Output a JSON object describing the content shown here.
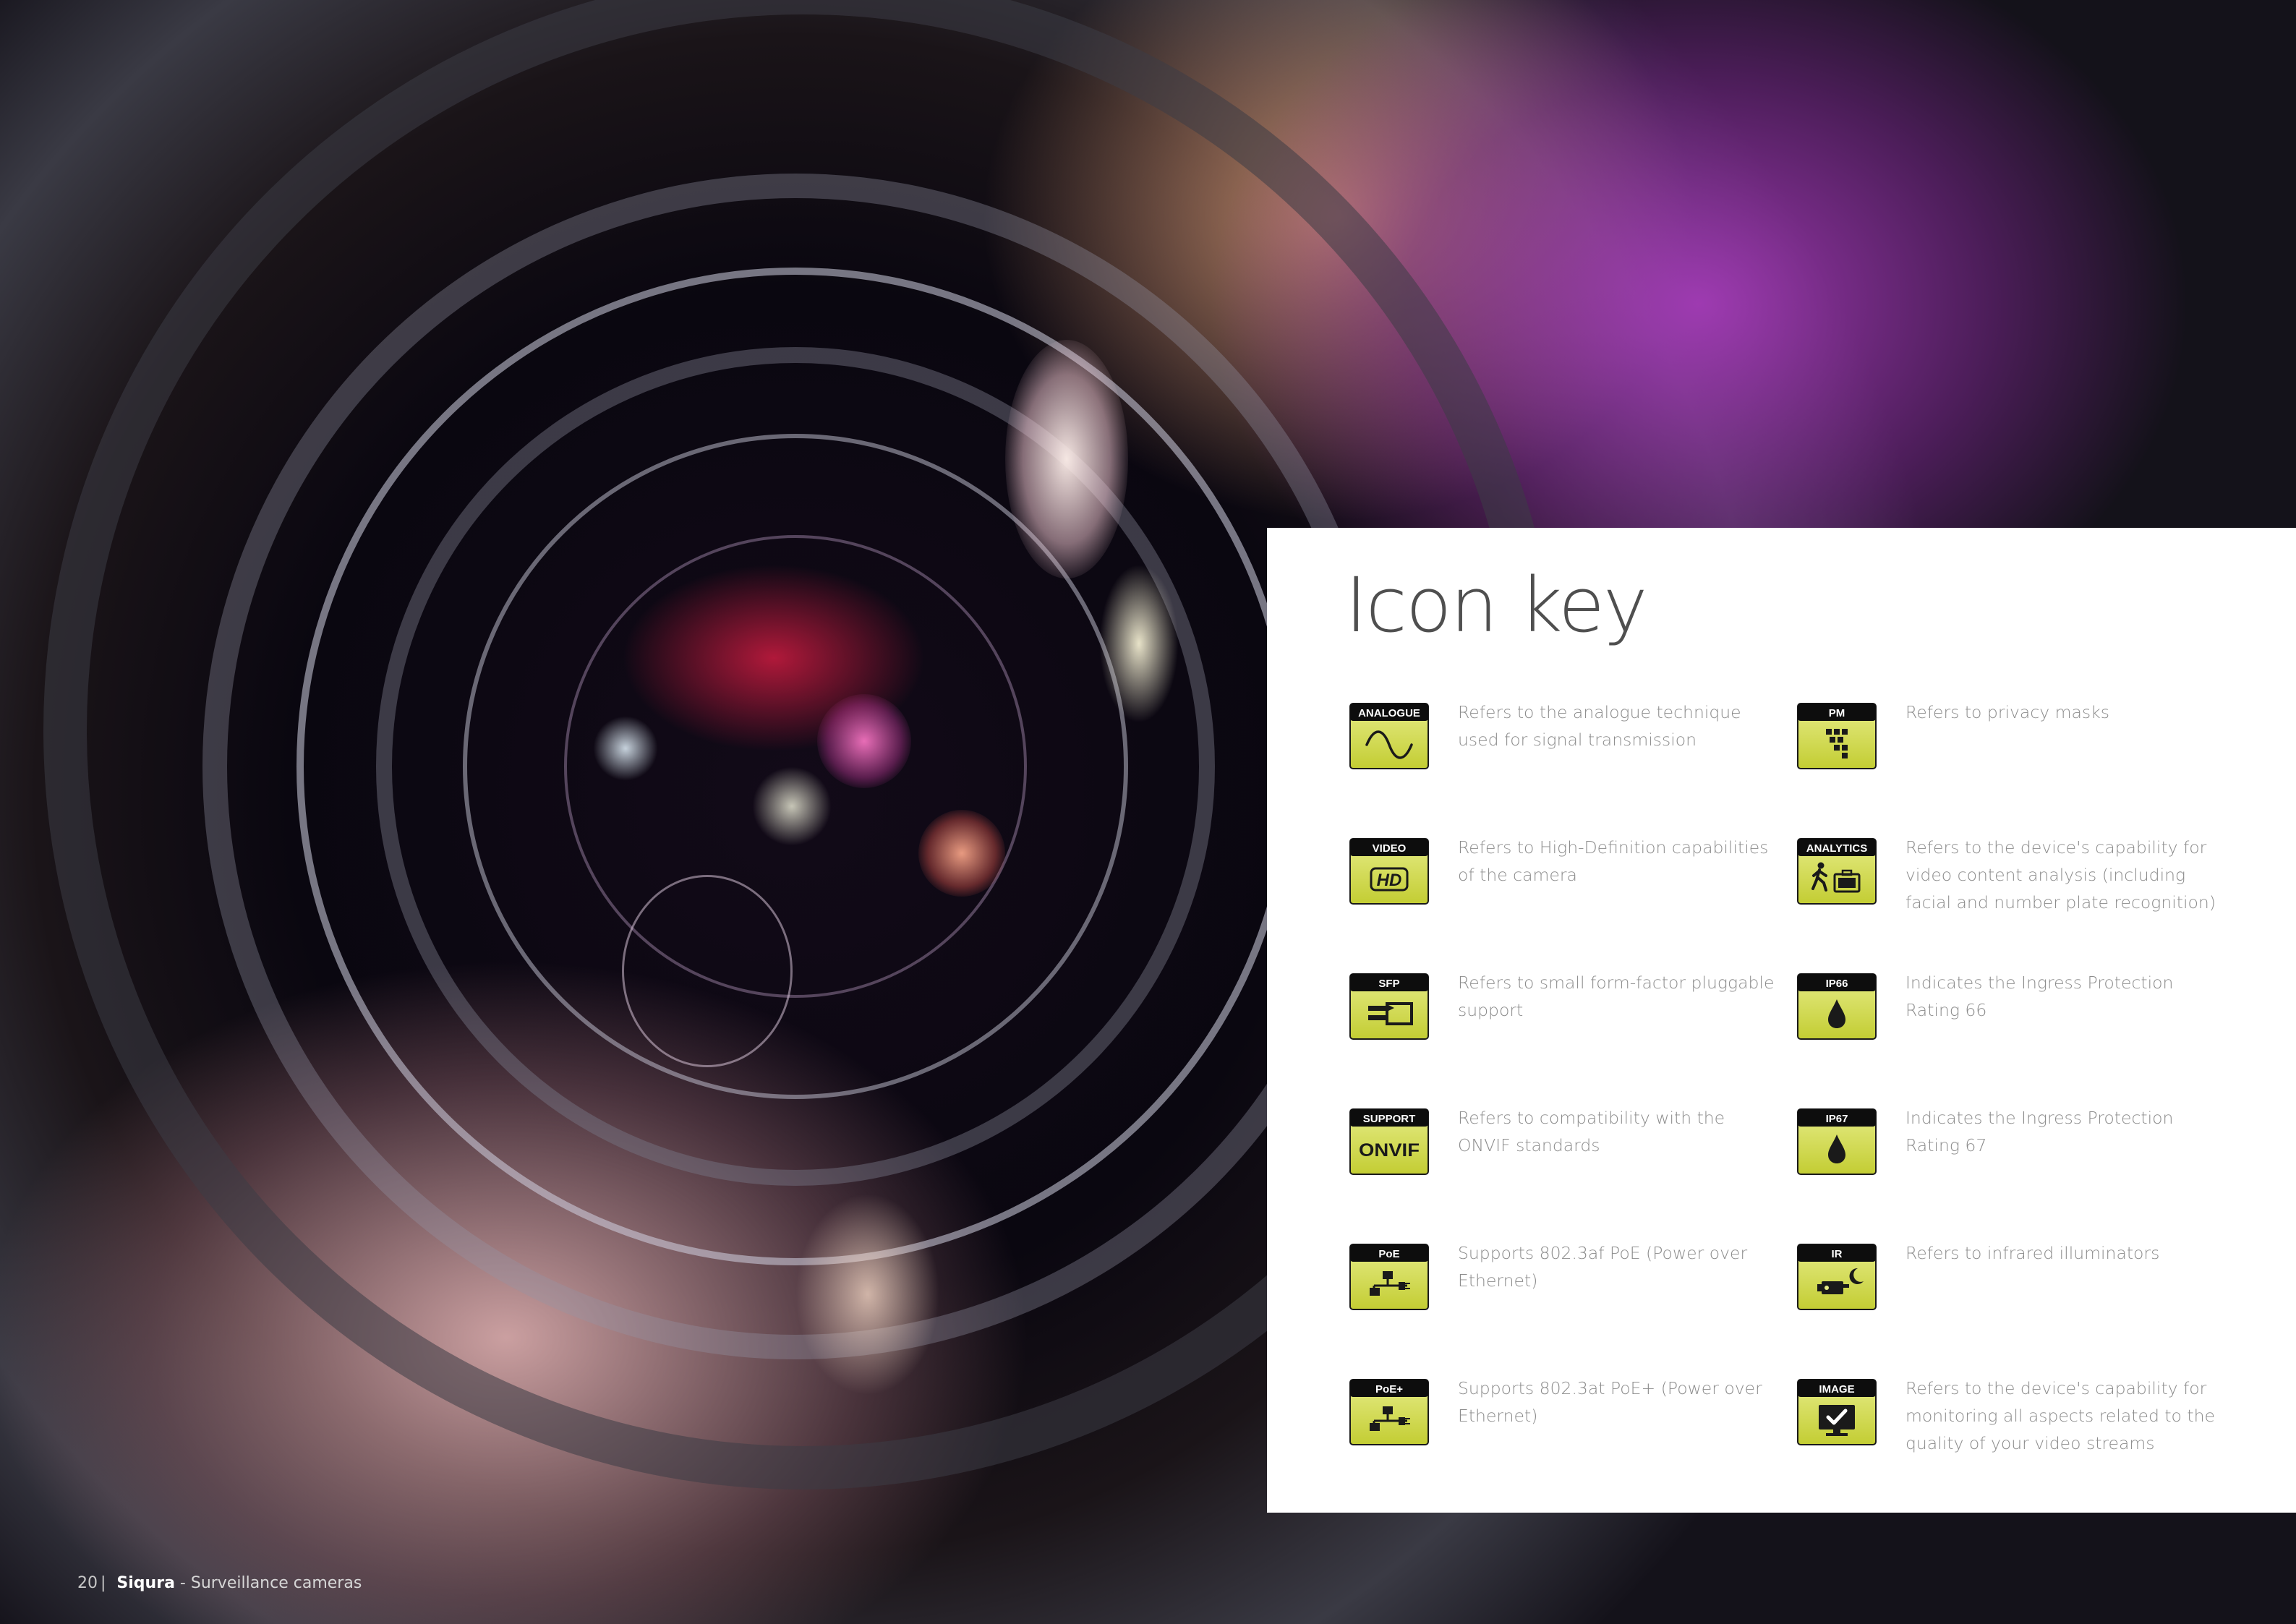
{
  "panel": {
    "title": "Icon key"
  },
  "icons": [
    {
      "badge": "ANALOGUE",
      "symbol": "sine-wave-icon",
      "desc": "Refers to the analogue technique used for signal transmission"
    },
    {
      "badge": "PM",
      "symbol": "privacy-mask-icon",
      "desc": "Refers to privacy masks"
    },
    {
      "badge": "VIDEO",
      "symbol": "hd-icon",
      "symbol_text": "HD",
      "desc": "Refers to High-Definition capabilities of the camera"
    },
    {
      "badge": "ANALYTICS",
      "symbol": "walking-person-luggage-icon",
      "desc": "Refers to the device's capability for video content analysis (including facial and number plate recognition)"
    },
    {
      "badge": "SFP",
      "symbol": "sfp-module-icon",
      "desc": "Refers to small form-factor pluggable support"
    },
    {
      "badge": "IP66",
      "symbol": "water-drop-icon",
      "desc": "Indicates the Ingress Protection Rating 66"
    },
    {
      "badge": "SUPPORT",
      "symbol": "onvif-logo-icon",
      "symbol_text": "ONVIF",
      "desc": "Refers to compatibility with the ONVIF standards"
    },
    {
      "badge": "IP67",
      "symbol": "water-drop-icon",
      "desc": "Indicates the Ingress Protection Rating 67"
    },
    {
      "badge": "PoE",
      "symbol": "network-plug-icon",
      "desc": "Supports 802.3af PoE (Power over Ethernet)"
    },
    {
      "badge": "IR",
      "symbol": "camera-moon-icon",
      "desc": "Refers to infrared illuminators"
    },
    {
      "badge": "PoE+",
      "symbol": "network-plug-icon",
      "desc": "Supports 802.3at PoE+ (Power over Ethernet)"
    },
    {
      "badge": "IMAGE",
      "symbol": "monitor-check-icon",
      "desc": "Refers to the device's capability for monitoring all aspects related to the quality of your video streams"
    }
  ],
  "colors": {
    "badge_top": "#0d0d0d",
    "badge_fill": "#cbd53f",
    "badge_fill_light": "#e6ec86",
    "panel": "#ffffff",
    "text": "#8c8c8c",
    "title": "#4f4f4f"
  },
  "footer": {
    "page_number": "20",
    "brand": "Siqura",
    "tagline": "- Surveillance cameras"
  }
}
